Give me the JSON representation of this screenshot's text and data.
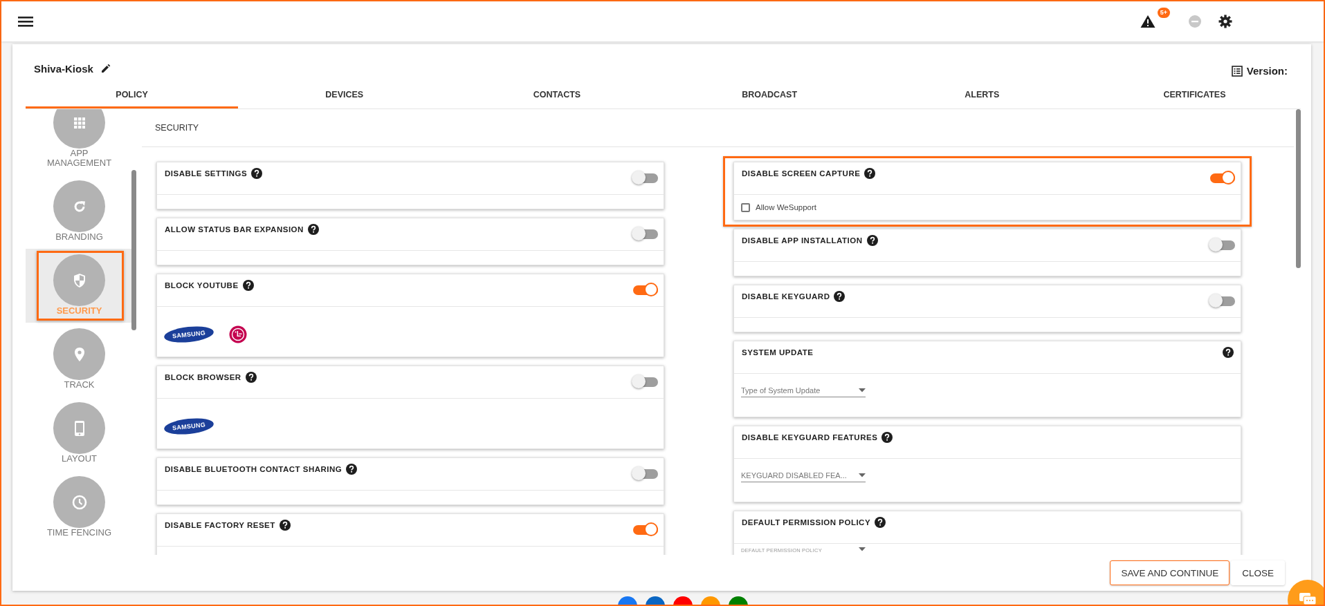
{
  "topbar": {
    "alert_badge": "5+"
  },
  "header": {
    "title": "Shiva-Kiosk",
    "version_label": "Version:"
  },
  "tabs": [
    {
      "label": "POLICY",
      "selected": true
    },
    {
      "label": "DEVICES",
      "selected": false
    },
    {
      "label": "CONTACTS",
      "selected": false
    },
    {
      "label": "BROADCAST",
      "selected": false
    },
    {
      "label": "ALERTS",
      "selected": false
    },
    {
      "label": "CERTIFICATES",
      "selected": false
    }
  ],
  "sidebar": {
    "items": [
      {
        "label": "APP MANAGEMENT",
        "selected": false
      },
      {
        "label": "BRANDING",
        "selected": false
      },
      {
        "label": "SECURITY",
        "selected": true
      },
      {
        "label": "TRACK",
        "selected": false
      },
      {
        "label": "LAYOUT",
        "selected": false
      },
      {
        "label": "TIME FENCING",
        "selected": false
      }
    ]
  },
  "section_title": "SECURITY",
  "columns": [
    [
      {
        "kind": "toggle",
        "title": "DISABLE SETTINGS",
        "on": false
      },
      {
        "kind": "toggle",
        "title": "ALLOW STATUS BAR EXPANSION",
        "on": false
      },
      {
        "kind": "toggle",
        "title": "BLOCK YOUTUBE",
        "on": true,
        "logos": [
          {
            "kind": "oval",
            "text": "SAMSUNG"
          },
          {
            "kind": "circle"
          }
        ]
      },
      {
        "kind": "toggle",
        "title": "BLOCK BROWSER",
        "on": false,
        "logos": [
          {
            "kind": "oval",
            "text": "SAMSUNG"
          }
        ]
      },
      {
        "kind": "toggle",
        "title": "DISABLE BLUETOOTH CONTACT SHARING",
        "on": false
      },
      {
        "kind": "toggle",
        "title": "DISABLE FACTORY RESET",
        "on": true
      }
    ],
    [
      {
        "kind": "toggle",
        "title": "DISABLE SCREEN CAPTURE",
        "on": true,
        "highlighted": true,
        "checkbox": {
          "label": "Allow WeSupport",
          "checked": false
        }
      },
      {
        "kind": "toggle",
        "title": "DISABLE APP INSTALLATION",
        "on": false
      },
      {
        "kind": "toggle",
        "title": "DISABLE KEYGUARD",
        "on": false
      },
      {
        "kind": "select",
        "title": "SYSTEM UPDATE",
        "help_right": true,
        "field": {
          "placeholder": "Type of System Update"
        }
      },
      {
        "kind": "select",
        "title": "DISABLE KEYGUARD FEATURES",
        "field": {
          "placeholder": "KEYGUARD DISABLED FEA..."
        }
      },
      {
        "kind": "select",
        "title": "DEFAULT PERMISSION POLICY",
        "field": {
          "label": "DEFAULT PERMISSION POLICY"
        }
      }
    ]
  ],
  "buttons": [
    {
      "label": "SAVE AND CONTINUE",
      "primary": true
    },
    {
      "label": "CLOSE",
      "primary": false
    }
  ],
  "footer": {
    "social": [
      {
        "color": "#1877f2"
      },
      {
        "color": "#0a66c2"
      },
      {
        "color": "#ff0000"
      },
      {
        "color": "#ff9800"
      },
      {
        "color": "#008000"
      }
    ]
  }
}
